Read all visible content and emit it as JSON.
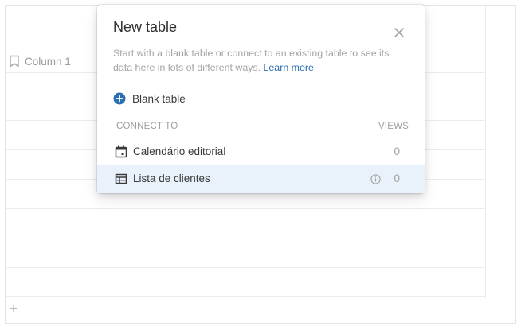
{
  "background_table": {
    "column_header": "Column 1",
    "add_row_label": "+"
  },
  "dialog": {
    "title": "New table",
    "description": "Start with a blank table or connect to an existing table to see its data here in lots of different ways.",
    "learn_more": "Learn more",
    "blank_table_label": "Blank table",
    "connect_to_header": "CONNECT TO",
    "views_header": "VIEWS",
    "connections": [
      {
        "name": "Calendário editorial",
        "views": "0",
        "icon": "calendar-icon"
      },
      {
        "name": "Lista de clientes",
        "views": "0",
        "icon": "table-icon",
        "highlighted": true
      }
    ]
  },
  "colors": {
    "accent": "#2a6fb2",
    "highlight_row": "#e9f2fa"
  }
}
